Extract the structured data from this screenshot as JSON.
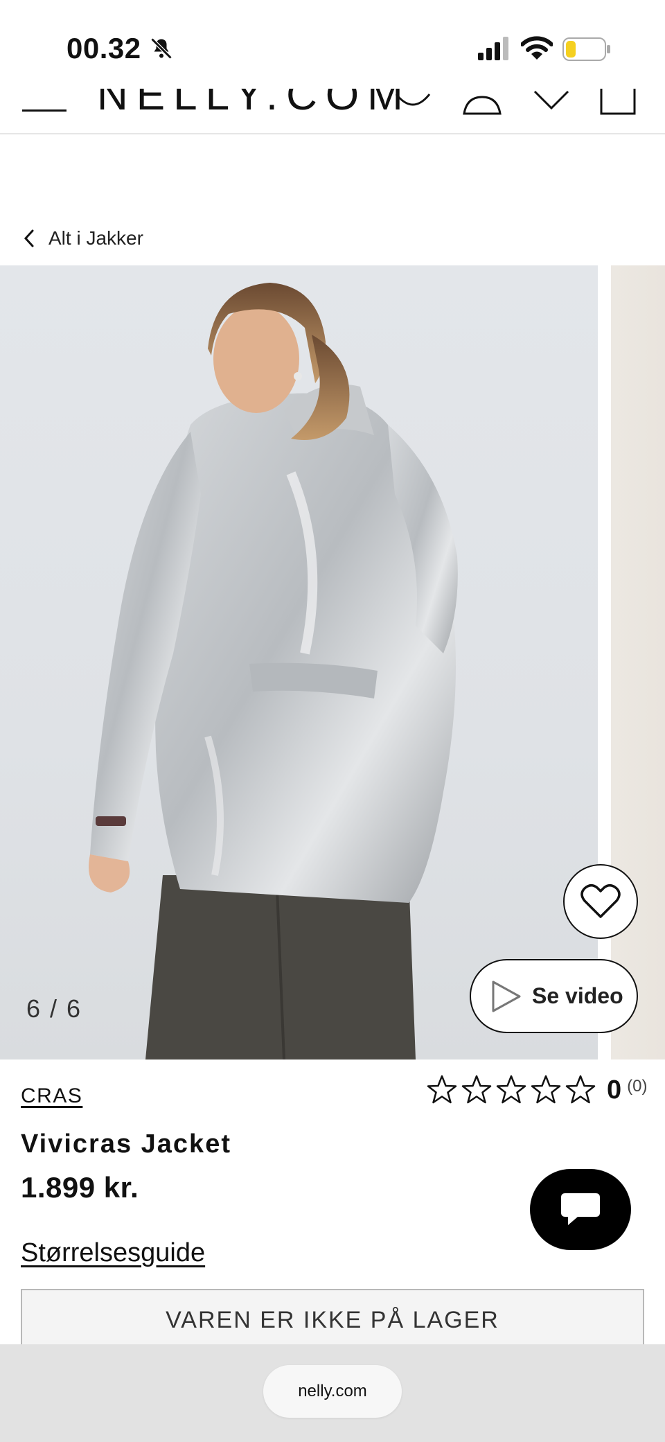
{
  "status_bar": {
    "time": "00.32",
    "icons": [
      "bell-slash-icon",
      "signal-icon",
      "wifi-icon",
      "battery-icon"
    ]
  },
  "header": {
    "logo": "NELLY.COM",
    "icons": [
      "menu-icon",
      "search-icon",
      "account-icon",
      "heart-icon",
      "bag-icon"
    ]
  },
  "breadcrumb": {
    "label": "Alt i Jakker"
  },
  "gallery": {
    "counter": "6 / 6",
    "video_label": "Se video"
  },
  "product": {
    "brand": "CRAS",
    "name": "Vivicras Jacket",
    "price": "1.899 kr.",
    "rating": "0",
    "rating_count": "(0)",
    "stars_filled": 0,
    "size_guide": "Størrelsesguide",
    "stock_label": "VAREN ER IKKE PÅ LAGER"
  },
  "browser": {
    "url": "nelly.com"
  },
  "colors": {
    "text": "#111111",
    "accent": "#000000",
    "battery": "#f5d020"
  }
}
